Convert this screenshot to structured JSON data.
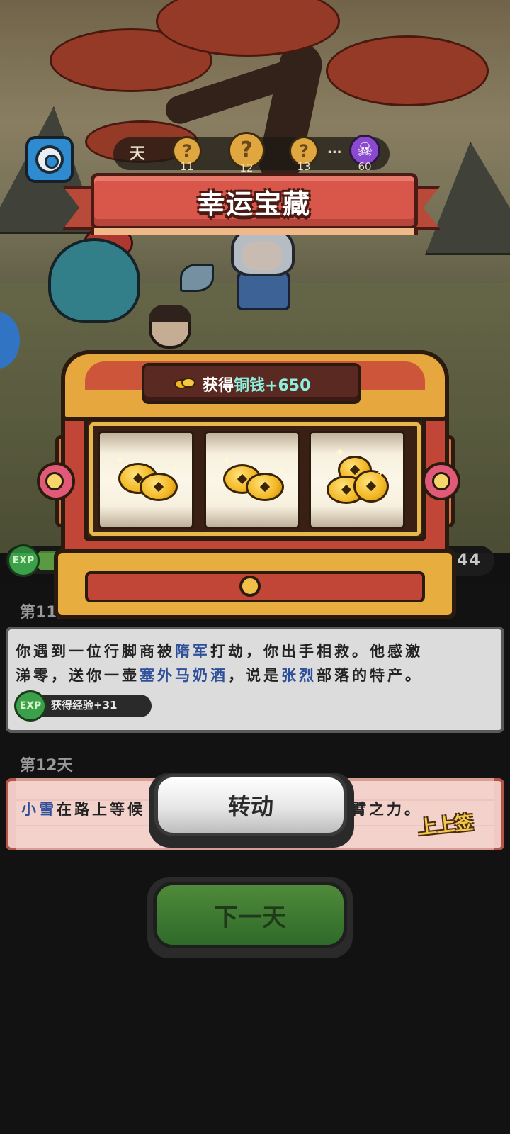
{
  "header": {
    "day_label": "天",
    "nodes": [
      {
        "symbol": "?",
        "number": "11"
      },
      {
        "symbol": "?",
        "number": "12"
      },
      {
        "symbol": "?",
        "number": "13"
      }
    ],
    "ellipsis": "...",
    "boss": {
      "symbol": "☠",
      "number": "60"
    }
  },
  "popup": {
    "title": "幸运宝藏",
    "reward_prefix": "获得",
    "reward_currency": "铜钱",
    "reward_amount": "+650",
    "reels": [
      "coin",
      "coin",
      "coins-stack"
    ]
  },
  "status": {
    "exp_badge": "EXP",
    "right_counter": "644"
  },
  "log": {
    "entries": [
      {
        "day": "第11天",
        "line1_parts": [
          "你遇到一位行脚商被",
          "隋军",
          "打劫，你出手相救。他感激"
        ],
        "line2_parts": [
          "涕零，送你一壶",
          "塞外马奶酒",
          "，说是",
          "张烈",
          "部落的特产。"
        ],
        "reward_badge": "EXP",
        "reward_text": "获得经验+31"
      },
      {
        "day": "第12天",
        "line_start_name": "小雪",
        "line_start_text": "在路上等候",
        "line_end_text": "臂之力。",
        "tag": "上上签"
      }
    ]
  },
  "buttons": {
    "spin": "转动",
    "next_day": "下一天"
  },
  "colors": {
    "highlight_blue": "#2e4f9a",
    "currency_cyan": "#8ef0dc",
    "ribbon_red": "#d9574a",
    "chest_gold": "#e6a83e",
    "next_green": "#2f6a2a"
  }
}
